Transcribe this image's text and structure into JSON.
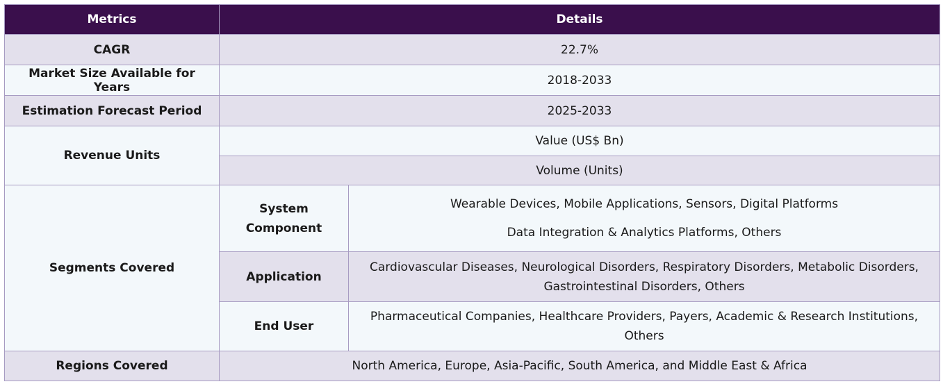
{
  "header": {
    "metrics": "Metrics",
    "details": "Details"
  },
  "rows": {
    "cagr": {
      "label": "CAGR",
      "value": "22.7%"
    },
    "market_size": {
      "label": "Market Size Available for Years",
      "value": "2018-2033"
    },
    "forecast": {
      "label": "Estimation Forecast Period",
      "value": "2025-2033"
    },
    "revenue": {
      "label": "Revenue Units",
      "values": [
        "Value (US$ Bn)",
        "Volume (Units)"
      ]
    },
    "segments": {
      "label": "Segments Covered",
      "items": [
        {
          "name_line1": "System",
          "name_line2": "Component",
          "lines": [
            "Wearable Devices, Mobile Applications, Sensors, Digital Platforms",
            "Data Integration & Analytics Platforms, Others"
          ]
        },
        {
          "name": "Application",
          "value": "Cardiovascular Diseases, Neurological Disorders, Respiratory Disorders, Metabolic Disorders, Gastrointestinal Disorders, Others"
        },
        {
          "name": "End User",
          "value": "Pharmaceutical Companies, Healthcare Providers, Payers, Academic & Research Institutions, Others"
        }
      ]
    },
    "regions": {
      "label": "Regions Covered",
      "value": "North America, Europe, Asia-Pacific, South America, and Middle East & Africa"
    }
  }
}
